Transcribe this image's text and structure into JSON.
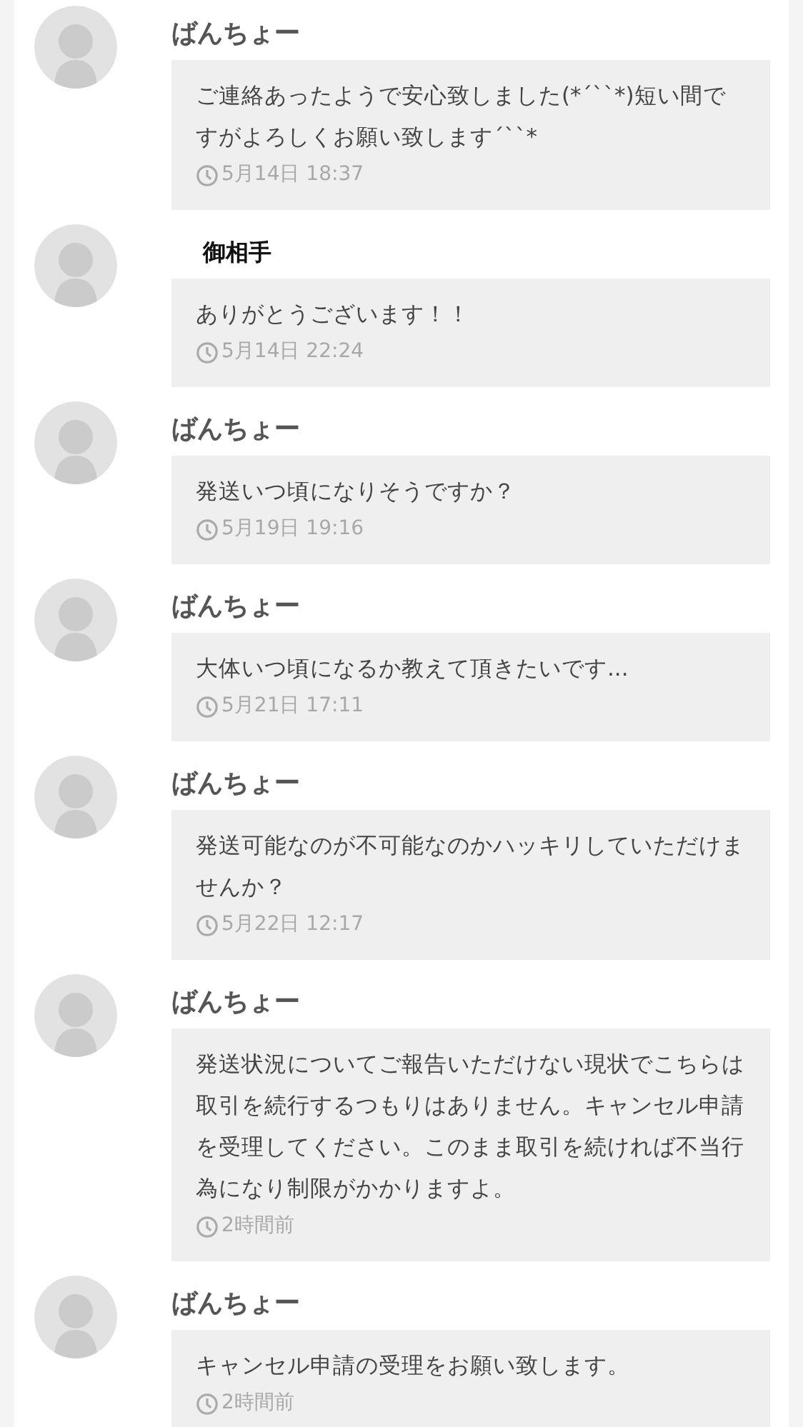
{
  "messages": [
    {
      "kind": "user",
      "sender": "ばんちょー",
      "text": "ご連絡あったようで安心致しました(*´``*)短い間ですがよろしくお願い致します´``*",
      "time": "5月14日 18:37"
    },
    {
      "kind": "partner",
      "sender": "御相手",
      "text": "ありがとうございます！！",
      "time": "5月14日 22:24"
    },
    {
      "kind": "user",
      "sender": "ばんちょー",
      "text": "発送いつ頃になりそうですか？",
      "time": "5月19日 19:16"
    },
    {
      "kind": "user",
      "sender": "ばんちょー",
      "text": "大体いつ頃になるか教えて頂きたいです...",
      "time": "5月21日 17:11"
    },
    {
      "kind": "user",
      "sender": "ばんちょー",
      "text": "発送可能なのが不可能なのかハッキリしていただけませんか？",
      "time": "5月22日 12:17"
    },
    {
      "kind": "user",
      "sender": "ばんちょー",
      "text": "発送状況についてご報告いただけない現状でこちらは取引を続行するつもりはありません。キャンセル申請を受理してください。このまま取引を続ければ不当行為になり制限がかかりますよ。",
      "time": "2時間前"
    },
    {
      "kind": "user",
      "sender": "ばんちょー",
      "text": "キャンセル申請の受理をお願い致します。",
      "time": "2時間前"
    }
  ]
}
